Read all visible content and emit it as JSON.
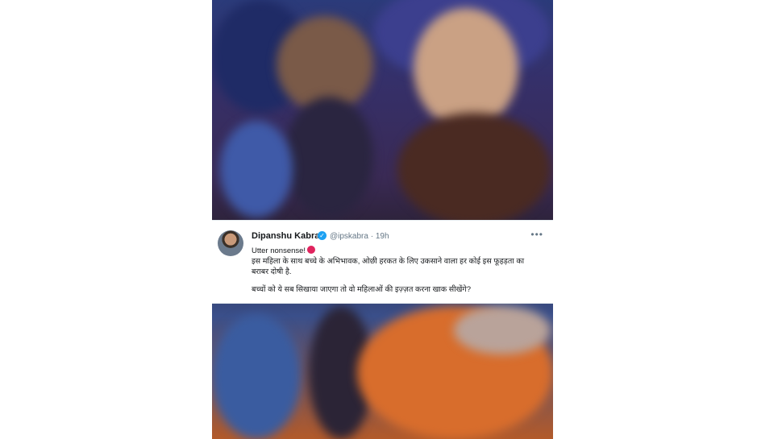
{
  "tweet": {
    "author_name": "Dipanshu Kabra",
    "handle": "@ipskabra",
    "separator": "·",
    "time": "19h",
    "more_label": "•••",
    "line1": "Utter nonsense!",
    "line2": "इस महिला के साथ बच्चे के अभिभावक, ओछी हरकत के लिए उकसाने वाला हर कोई इस फूहड़ता का बराबर दोषी है.",
    "line3": "बच्चों को ये सब सिखाया जाएगा तो वो महिलाओं की इज़्ज़त करना खाक सीखेंगे?"
  },
  "icons": {
    "verified": "verified-badge-icon",
    "more": "more-options-icon",
    "emoji": "angry-face-emoji-icon"
  },
  "colors": {
    "verified_blue": "#1da1f2",
    "text_primary": "#14171a",
    "text_secondary": "#657786"
  }
}
